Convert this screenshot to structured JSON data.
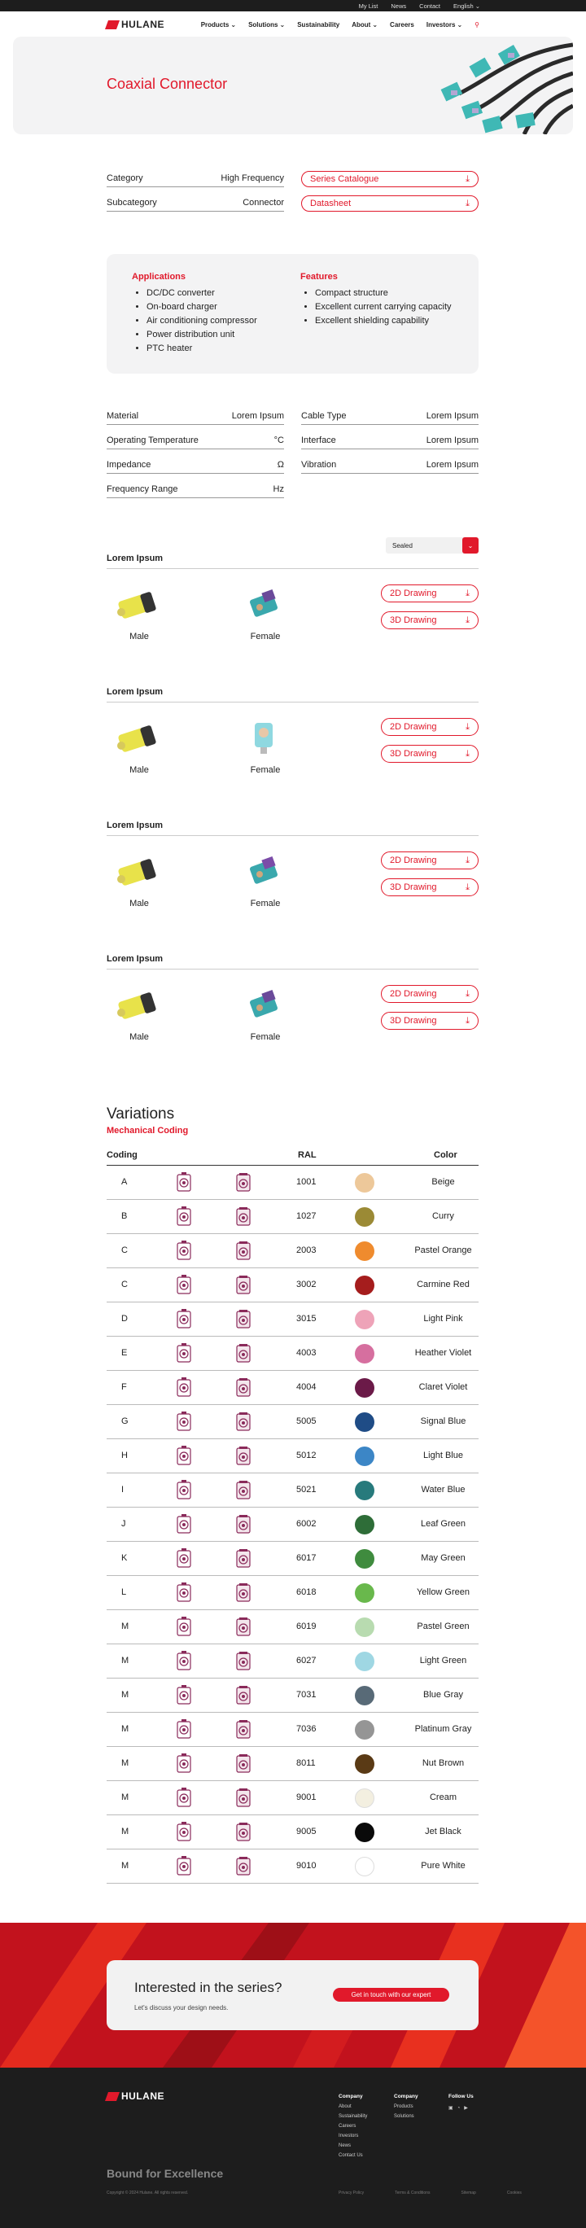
{
  "topbar": [
    "My List",
    "News",
    "Contact",
    "English"
  ],
  "nav": {
    "logo": "HULANE",
    "links": [
      "Products",
      "Solutions",
      "Sustainability",
      "About",
      "Careers",
      "Investors"
    ]
  },
  "hero": {
    "title": "Coaxial Connector"
  },
  "meta": {
    "category_label": "Category",
    "category_value": "High Frequency",
    "subcategory_label": "Subcategory",
    "subcategory_value": "Connector",
    "btn1": "Series Catalogue",
    "btn2": "Datasheet"
  },
  "apps": {
    "title": "Applications",
    "items": [
      "DC/DC converter",
      "On-board charger",
      "Air conditioning compressor",
      "Power distribution unit",
      "PTC heater"
    ],
    "features_title": "Features",
    "features": [
      "Compact structure",
      "Excellent current carrying capacity",
      "Excellent shielding capability"
    ]
  },
  "props": [
    [
      "Material",
      "Lorem Ipsum"
    ],
    [
      "Operating Temperature",
      "°C"
    ],
    [
      "Impedance",
      "Ω"
    ],
    [
      "Frequency Range",
      "Hz"
    ],
    [
      "Cable Type",
      "Lorem Ipsum"
    ],
    [
      "Interface",
      "Lorem Ipsum"
    ],
    [
      "Vibration",
      "Lorem Ipsum"
    ]
  ],
  "select": {
    "value": "Sealed"
  },
  "groups": [
    {
      "title": "Lorem Ipsum",
      "male": "Male",
      "female": "Female",
      "d2": "2D Drawing",
      "d3": "3D Drawing"
    },
    {
      "title": "Lorem Ipsum",
      "male": "Male",
      "female": "Female",
      "d2": "2D Drawing",
      "d3": "3D Drawing"
    },
    {
      "title": "Lorem Ipsum",
      "male": "Male",
      "female": "Female",
      "d2": "2D Drawing",
      "d3": "3D Drawing"
    },
    {
      "title": "Lorem Ipsum",
      "male": "Male",
      "female": "Female",
      "d2": "2D Drawing",
      "d3": "3D Drawing"
    }
  ],
  "variations": {
    "title": "Variations",
    "subtitle": "Mechanical Coding",
    "headers": [
      "Coding",
      "RAL",
      "Color"
    ],
    "rows": [
      [
        "A",
        "1001",
        "Beige",
        "#edc89a"
      ],
      [
        "B",
        "1027",
        "Curry",
        "#9b8a35"
      ],
      [
        "C",
        "2003",
        "Pastel Orange",
        "#ef8b2e"
      ],
      [
        "C",
        "3002",
        "Carmine Red",
        "#a51d1d"
      ],
      [
        "D",
        "3015",
        "Light Pink",
        "#eea3b8"
      ],
      [
        "E",
        "4003",
        "Heather Violet",
        "#d66f9f"
      ],
      [
        "F",
        "4004",
        "Claret Violet",
        "#6b1a48"
      ],
      [
        "G",
        "5005",
        "Signal Blue",
        "#1f4c86"
      ],
      [
        "H",
        "5012",
        "Light Blue",
        "#3c86c6"
      ],
      [
        "I",
        "5021",
        "Water Blue",
        "#277a7c"
      ],
      [
        "J",
        "6002",
        "Leaf Green",
        "#2e6d38"
      ],
      [
        "K",
        "6017",
        "May Green",
        "#3f8b3e"
      ],
      [
        "L",
        "6018",
        "Yellow Green",
        "#69b84c"
      ],
      [
        "M",
        "6019",
        "Pastel Green",
        "#b8dbb0"
      ],
      [
        "M",
        "6027",
        "Light Green",
        "#9fd7e3"
      ],
      [
        "M",
        "7031",
        "Blue Gray",
        "#586a77"
      ],
      [
        "M",
        "7036",
        "Platinum Gray",
        "#959595"
      ],
      [
        "M",
        "8011",
        "Nut Brown",
        "#5a3a15"
      ],
      [
        "M",
        "9001",
        "Cream",
        "#f3efe0"
      ],
      [
        "M",
        "9005",
        "Jet Black",
        "#0a0a0a"
      ],
      [
        "M",
        "9010",
        "Pure White",
        "#ffffff"
      ]
    ]
  },
  "cta": {
    "title": "Interested in the series?",
    "text": "Let's discuss your design needs.",
    "button": "Get in touch with our expert"
  },
  "footer": {
    "slogan": "Bound for Excellence",
    "copyright": "Copyright © 2024 Hulane. All rights reserved.",
    "col1_title": "Company",
    "col1": [
      "About",
      "Sustainability",
      "Careers",
      "Investors",
      "News",
      "Contact Us"
    ],
    "col2_title": "Company",
    "col2": [
      "Products",
      "Solutions"
    ],
    "col3_title": "Follow Us",
    "bottom": [
      "Privacy Policy",
      "Terms & Conditions",
      "Sitemap",
      "Cookies"
    ]
  }
}
